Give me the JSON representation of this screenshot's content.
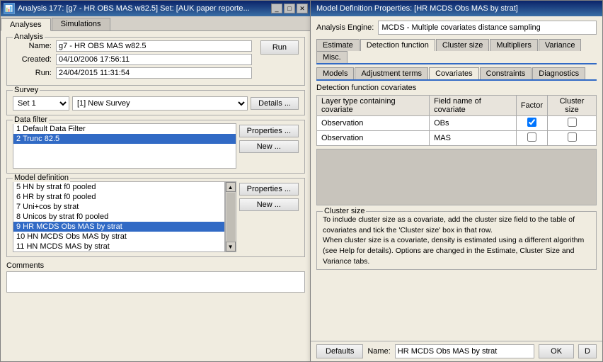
{
  "mainWindow": {
    "title": "Analysis 177: [g7 - HR OBS MAS w82.5] Set: [AUK paper reporte...",
    "tabs": [
      {
        "label": "Analyses",
        "active": true
      },
      {
        "label": "Simulations",
        "active": false
      }
    ],
    "analysis": {
      "groupLabel": "Analysis",
      "nameLabel": "Name:",
      "nameValue": "g7 - HR OBS MAS w82.5",
      "createdLabel": "Created:",
      "createdValue": "04/10/2006 17:56:11",
      "runLabel": "Run:",
      "runValue": "24/04/2015 11:31:54",
      "runButton": "Run"
    },
    "survey": {
      "groupLabel": "Survey",
      "set1": "Set 1",
      "surveyName": "[1] New Survey",
      "detailsButton": "Details ..."
    },
    "dataFilter": {
      "groupLabel": "Data filter",
      "items": [
        {
          "id": 1,
          "label": "1  Default Data Filter",
          "selected": false
        },
        {
          "id": 2,
          "label": "2  Trunc 82.5",
          "selected": true
        }
      ],
      "propertiesButton": "Properties ...",
      "newButton": "New ..."
    },
    "modelDefinition": {
      "groupLabel": "Model definition",
      "items": [
        {
          "id": 5,
          "label": "5  HN by strat f0 pooled"
        },
        {
          "id": 6,
          "label": "6  HR by strat f0 pooled"
        },
        {
          "id": 7,
          "label": "7  Uni+cos by strat"
        },
        {
          "id": 8,
          "label": "8  Unicos by strat f0 pooled"
        },
        {
          "id": 9,
          "label": "9  HR MCDS Obs MAS by strat",
          "selected": true
        },
        {
          "id": 10,
          "label": "10  HN MCDS Obs MAS by strat"
        },
        {
          "id": 11,
          "label": "11  HN MCDS MAS by strat"
        }
      ],
      "propertiesButton": "Properties ...",
      "newButton": "New ..."
    },
    "comments": {
      "label": "Comments"
    }
  },
  "modalWindow": {
    "title": "Model Definition Properties: [HR MCDS Obs MAS by strat]",
    "engineLabel": "Analysis Engine:",
    "engineValue": "MCDS - Multiple covariates distance sampling",
    "tabs": [
      {
        "label": "Estimate"
      },
      {
        "label": "Detection function",
        "active": true
      },
      {
        "label": "Cluster size"
      },
      {
        "label": "Multipliers"
      },
      {
        "label": "Variance"
      },
      {
        "label": "Misc."
      }
    ],
    "tabs2": [
      {
        "label": "Models"
      },
      {
        "label": "Adjustment terms"
      },
      {
        "label": "Covariates",
        "active": true
      },
      {
        "label": "Constraints"
      },
      {
        "label": "Diagnostics"
      }
    ],
    "detectionFunctionCovariates": {
      "sectionTitle": "Detection function covariates",
      "tableHeaders": [
        "Layer type containing covariate",
        "Field name of covariate",
        "Factor",
        "Cluster size"
      ],
      "rows": [
        {
          "layer": "Observation",
          "field": "OBs",
          "factor": true,
          "clusterSize": false
        },
        {
          "layer": "Observation",
          "field": "MAS",
          "factor": false,
          "clusterSize": false
        }
      ]
    },
    "clusterSize": {
      "label": "Cluster size",
      "text": "To include cluster size as a covariate, add the cluster size field to the table of covariates and tick the 'Cluster size' box in that row.\nWhen cluster size is a covariate, density is estimated using a different algorithm (see Help for details).  Options are changed in the Estimate, Cluster Size and Variance tabs."
    },
    "footer": {
      "defaultsButton": "Defaults",
      "nameLabel": "Name:",
      "nameValue": "HR MCDS Obs MAS by strat",
      "okButton": "OK"
    }
  }
}
